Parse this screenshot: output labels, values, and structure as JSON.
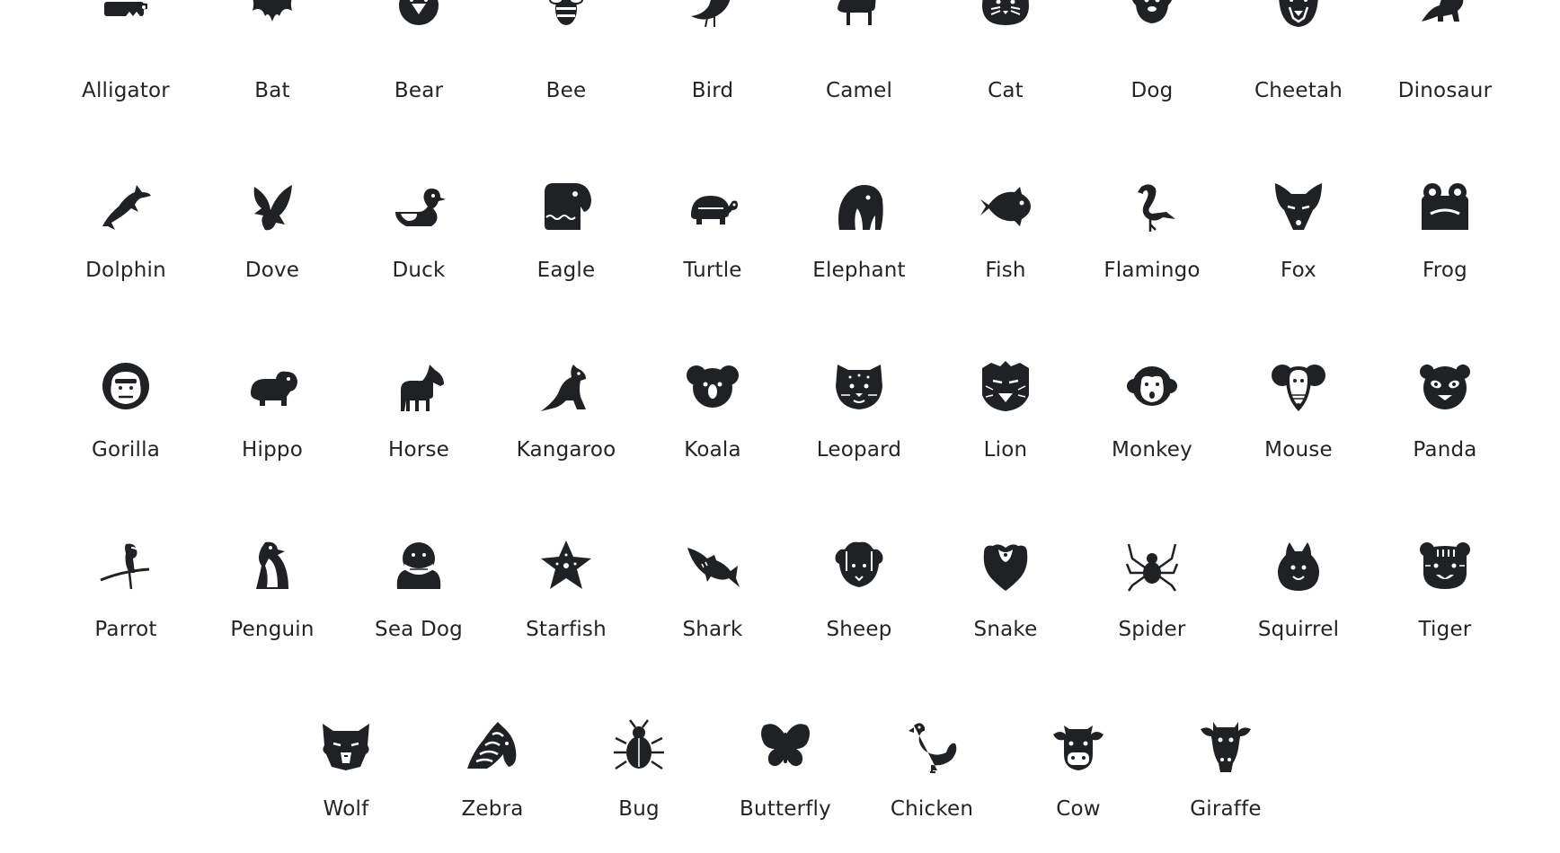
{
  "theme": {
    "icon_color": "#1f2125",
    "text_color": "#222428",
    "background": "#ffffff"
  },
  "rows": [
    [
      {
        "label": "Alligator",
        "icon": "alligator-icon"
      },
      {
        "label": "Bat",
        "icon": "bat-icon"
      },
      {
        "label": "Bear",
        "icon": "bear-icon"
      },
      {
        "label": "Bee",
        "icon": "bee-icon"
      },
      {
        "label": "Bird",
        "icon": "bird-icon"
      },
      {
        "label": "Camel",
        "icon": "camel-icon"
      },
      {
        "label": "Cat",
        "icon": "cat-icon"
      },
      {
        "label": "Dog",
        "icon": "dog-icon"
      },
      {
        "label": "Cheetah",
        "icon": "cheetah-icon"
      },
      {
        "label": "Dinosaur",
        "icon": "dinosaur-icon"
      }
    ],
    [
      {
        "label": "Dolphin",
        "icon": "dolphin-icon"
      },
      {
        "label": "Dove",
        "icon": "dove-icon"
      },
      {
        "label": "Duck",
        "icon": "duck-icon"
      },
      {
        "label": "Eagle",
        "icon": "eagle-icon"
      },
      {
        "label": "Turtle",
        "icon": "turtle-icon"
      },
      {
        "label": "Elephant",
        "icon": "elephant-icon"
      },
      {
        "label": "Fish",
        "icon": "fish-icon"
      },
      {
        "label": "Flamingo",
        "icon": "flamingo-icon"
      },
      {
        "label": "Fox",
        "icon": "fox-icon"
      },
      {
        "label": "Frog",
        "icon": "frog-icon"
      }
    ],
    [
      {
        "label": "Gorilla",
        "icon": "gorilla-icon"
      },
      {
        "label": "Hippo",
        "icon": "hippo-icon"
      },
      {
        "label": "Horse",
        "icon": "horse-icon"
      },
      {
        "label": "Kangaroo",
        "icon": "kangaroo-icon"
      },
      {
        "label": "Koala",
        "icon": "koala-icon"
      },
      {
        "label": "Leopard",
        "icon": "leopard-icon"
      },
      {
        "label": "Lion",
        "icon": "lion-icon"
      },
      {
        "label": "Monkey",
        "icon": "monkey-icon"
      },
      {
        "label": "Mouse",
        "icon": "mouse-icon"
      },
      {
        "label": "Panda",
        "icon": "panda-icon"
      }
    ],
    [
      {
        "label": "Parrot",
        "icon": "parrot-icon"
      },
      {
        "label": "Penguin",
        "icon": "penguin-icon"
      },
      {
        "label": "Sea Dog",
        "icon": "sea-dog-icon"
      },
      {
        "label": "Starfish",
        "icon": "starfish-icon"
      },
      {
        "label": "Shark",
        "icon": "shark-icon"
      },
      {
        "label": "Sheep",
        "icon": "sheep-icon"
      },
      {
        "label": "Snake",
        "icon": "snake-icon"
      },
      {
        "label": "Spider",
        "icon": "spider-icon"
      },
      {
        "label": "Squirrel",
        "icon": "squirrel-icon"
      },
      {
        "label": "Tiger",
        "icon": "tiger-icon"
      }
    ],
    [
      {
        "label": "Wolf",
        "icon": "wolf-icon"
      },
      {
        "label": "Zebra",
        "icon": "zebra-icon"
      },
      {
        "label": "Bug",
        "icon": "bug-icon"
      },
      {
        "label": "Butterfly",
        "icon": "butterfly-icon"
      },
      {
        "label": "Chicken",
        "icon": "chicken-icon"
      },
      {
        "label": "Cow",
        "icon": "cow-icon"
      },
      {
        "label": "Giraffe",
        "icon": "giraffe-icon"
      }
    ]
  ]
}
